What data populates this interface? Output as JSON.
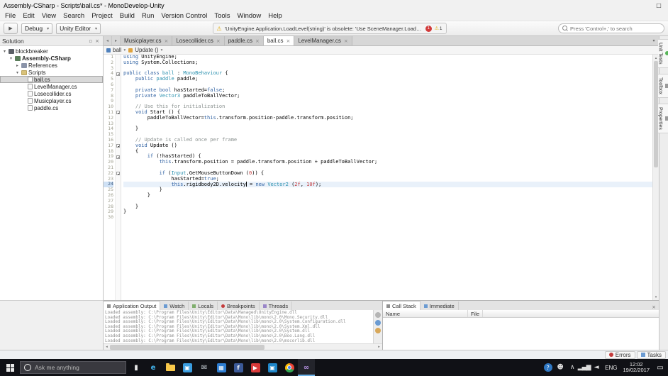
{
  "window": {
    "title": "Assembly-CSharp - Scripts\\ball.cs* - MonoDevelop-Unity",
    "controls": [
      {
        "name": "minimize",
        "glyph": "–"
      },
      {
        "name": "maximize",
        "glyph": "□"
      },
      {
        "name": "close",
        "glyph": "×"
      }
    ]
  },
  "icons": {
    "play": "▶",
    "chevron_down": "▾",
    "warning": "⚠",
    "close": "×",
    "back": "◂",
    "forward": "▸",
    "up": "▴",
    "down": "▾",
    "left": "◂",
    "right": "▸",
    "dock": "▫"
  },
  "menu": {
    "items": [
      "File",
      "Edit",
      "View",
      "Search",
      "Project",
      "Build",
      "Run",
      "Version Control",
      "Tools",
      "Window",
      "Help"
    ]
  },
  "toolbar": {
    "config": "Debug",
    "target": "Unity Editor",
    "warning": "'UnityEngine.Application.LoadLevel(string)' is obsolete: 'Use SceneManager.LoadScene' (CS0618)",
    "error_count": "1",
    "warning_count": "1",
    "search_placeholder": "Press 'Control+,' to search"
  },
  "solution": {
    "header": "Solution",
    "tree": [
      {
        "label": "blockbreaker",
        "level": 0,
        "icon": "solution",
        "arrow": "▾"
      },
      {
        "label": "Assembly-CSharp",
        "level": 1,
        "icon": "project",
        "arrow": "▾",
        "bold": true
      },
      {
        "label": "References",
        "level": 2,
        "icon": "references",
        "arrow": "▸"
      },
      {
        "label": "Scripts",
        "level": 2,
        "icon": "folder",
        "arrow": "▾"
      },
      {
        "label": "ball.cs",
        "level": 3,
        "icon": "file",
        "selected": true
      },
      {
        "label": "LevelManager.cs",
        "level": 3,
        "icon": "file"
      },
      {
        "label": "Losecollider.cs",
        "level": 3,
        "icon": "file"
      },
      {
        "label": "Musicplayer.cs",
        "level": 3,
        "icon": "file"
      },
      {
        "label": "paddle.cs",
        "level": 3,
        "icon": "file"
      }
    ]
  },
  "doc_tabs": [
    {
      "label": "Musicplayer.cs"
    },
    {
      "label": "Losecollider.cs"
    },
    {
      "label": "paddle.cs"
    },
    {
      "label": "ball.cs",
      "active": true
    },
    {
      "label": "LevelManager.cs"
    }
  ],
  "breadcrumb": [
    {
      "label": "ball"
    },
    {
      "label": "Update ()"
    }
  ],
  "editor": {
    "colors": {
      "keyword": "#3364a4",
      "type": "#2b91af",
      "comment": "#8a918f",
      "number": "#c43c3c",
      "plain": "#000000"
    },
    "lines": [
      {
        "n": 1,
        "seg": [
          [
            "k",
            "using"
          ],
          [
            "p",
            " UnityEngine;"
          ]
        ]
      },
      {
        "n": 2,
        "seg": [
          [
            "k",
            "using"
          ],
          [
            "p",
            " System.Collections;"
          ]
        ]
      },
      {
        "n": 3,
        "seg": []
      },
      {
        "n": 4,
        "fold": true,
        "seg": [
          [
            "k",
            "public"
          ],
          [
            "p",
            " "
          ],
          [
            "k",
            "class"
          ],
          [
            "p",
            " "
          ],
          [
            "t",
            "ball"
          ],
          [
            "p",
            " : "
          ],
          [
            "t",
            "MonoBehaviour"
          ],
          [
            "p",
            " {"
          ]
        ]
      },
      {
        "n": 5,
        "seg": [
          [
            "p",
            "    "
          ],
          [
            "k",
            "public"
          ],
          [
            "p",
            " "
          ],
          [
            "t",
            "paddle"
          ],
          [
            "p",
            " paddle;"
          ]
        ]
      },
      {
        "n": 6,
        "seg": []
      },
      {
        "n": 7,
        "seg": [
          [
            "p",
            "    "
          ],
          [
            "k",
            "private"
          ],
          [
            "p",
            " "
          ],
          [
            "k",
            "bool"
          ],
          [
            "p",
            " hasStarted="
          ],
          [
            "k",
            "false"
          ],
          [
            "p",
            ";"
          ]
        ]
      },
      {
        "n": 8,
        "seg": [
          [
            "p",
            "    "
          ],
          [
            "k",
            "private"
          ],
          [
            "p",
            " "
          ],
          [
            "t",
            "Vector3"
          ],
          [
            "p",
            " paddleToBallVector;"
          ]
        ]
      },
      {
        "n": 9,
        "seg": []
      },
      {
        "n": 10,
        "seg": [
          [
            "p",
            "    "
          ],
          [
            "c",
            "// Use this for initialization"
          ]
        ]
      },
      {
        "n": 11,
        "fold": true,
        "seg": [
          [
            "p",
            "    "
          ],
          [
            "k",
            "void"
          ],
          [
            "p",
            " Start () {"
          ]
        ]
      },
      {
        "n": 12,
        "seg": [
          [
            "p",
            "        paddleToBallVector="
          ],
          [
            "k",
            "this"
          ],
          [
            "p",
            ".transform.position-paddle.transform.position;"
          ]
        ]
      },
      {
        "n": 13,
        "seg": []
      },
      {
        "n": 14,
        "seg": [
          [
            "p",
            "    }"
          ]
        ]
      },
      {
        "n": 15,
        "seg": []
      },
      {
        "n": 16,
        "seg": [
          [
            "p",
            "    "
          ],
          [
            "c",
            "// Update is called once per frame"
          ]
        ]
      },
      {
        "n": 17,
        "fold": true,
        "seg": [
          [
            "p",
            "    "
          ],
          [
            "k",
            "void"
          ],
          [
            "p",
            " Update ()"
          ]
        ]
      },
      {
        "n": 18,
        "seg": [
          [
            "p",
            "    {"
          ]
        ]
      },
      {
        "n": 19,
        "fold": true,
        "seg": [
          [
            "p",
            "        "
          ],
          [
            "k",
            "if"
          ],
          [
            "p",
            " (!hasStarted) {"
          ]
        ]
      },
      {
        "n": 20,
        "seg": [
          [
            "p",
            "            "
          ],
          [
            "k",
            "this"
          ],
          [
            "p",
            ".transform.position = paddle.transform.position + paddleToBallVector;"
          ]
        ]
      },
      {
        "n": 21,
        "seg": []
      },
      {
        "n": 22,
        "fold": true,
        "seg": [
          [
            "p",
            "            "
          ],
          [
            "k",
            "if"
          ],
          [
            "p",
            " ("
          ],
          [
            "t",
            "Input"
          ],
          [
            "p",
            ".GetMouseButtonDown ("
          ],
          [
            "n2",
            "0"
          ],
          [
            "p",
            ")) {"
          ]
        ]
      },
      {
        "n": 23,
        "seg": [
          [
            "p",
            "                hasStarted="
          ],
          [
            "k",
            "true"
          ],
          [
            "p",
            ";"
          ]
        ]
      },
      {
        "n": 24,
        "cur": true,
        "seg": [
          [
            "p",
            "                "
          ],
          [
            "k",
            "this"
          ],
          [
            "p",
            ".rigidbody2D.velocity"
          ],
          [
            "caret",
            ""
          ],
          [
            "p",
            " = "
          ],
          [
            "k",
            "new"
          ],
          [
            "p",
            " "
          ],
          [
            "t",
            "Vector2"
          ],
          [
            "p",
            " ("
          ],
          [
            "n2",
            "2f"
          ],
          [
            "p",
            ", "
          ],
          [
            "n2",
            "10f"
          ],
          [
            "p",
            ");"
          ]
        ]
      },
      {
        "n": 25,
        "seg": [
          [
            "p",
            "            }"
          ]
        ]
      },
      {
        "n": 26,
        "seg": [
          [
            "p",
            "        }"
          ]
        ]
      },
      {
        "n": 27,
        "seg": []
      },
      {
        "n": 28,
        "seg": [
          [
            "p",
            "    }"
          ]
        ]
      },
      {
        "n": 29,
        "seg": [
          [
            "p",
            "}"
          ]
        ]
      },
      {
        "n": 30,
        "seg": []
      }
    ]
  },
  "right_dock": {
    "tabs": [
      {
        "label": "Unit Tests"
      },
      {
        "label": "Toolbox"
      },
      {
        "label": "Properties"
      }
    ]
  },
  "bottom_left": {
    "tabs": [
      {
        "label": "Application Output",
        "active": true
      },
      {
        "label": "Watch"
      },
      {
        "label": "Locals"
      },
      {
        "label": "Breakpoints"
      },
      {
        "label": "Threads"
      }
    ],
    "output": [
      "Loaded assembly: C:\\Program Files\\Unity\\Editor\\Data\\Managed\\UnityEngine.dll",
      "Loaded assembly: C:\\Program Files\\Unity\\Editor\\Data\\Mono\\lib\\mono\\2.0\\Mono.Security.dll",
      "Loaded assembly: C:\\Program Files\\Unity\\Editor\\Data\\Mono\\lib\\mono\\2.0\\System.Configuration.dll",
      "Loaded assembly: C:\\Program Files\\Unity\\Editor\\Data\\Mono\\lib\\mono\\2.0\\System.Xml.dll",
      "Loaded assembly: C:\\Program Files\\Unity\\Editor\\Data\\Mono\\lib\\mono\\2.0\\System.dll",
      "Loaded assembly: C:\\Program Files\\Unity\\Editor\\Data\\Mono\\lib\\mono\\2.0\\Boo.Lang.dll",
      "Loaded assembly: C:\\Program Files\\Unity\\Editor\\Data\\Mono\\lib\\mono\\2.0\\mscorlib.dll"
    ]
  },
  "bottom_right": {
    "tabs": [
      {
        "label": "Call Stack",
        "active": true
      },
      {
        "label": "Immediate"
      }
    ],
    "columns": [
      "Name",
      "File"
    ]
  },
  "status": {
    "buttons": [
      {
        "label": "Errors"
      },
      {
        "label": "Tasks"
      }
    ]
  },
  "taskbar": {
    "search": "Ask me anything",
    "apps": [
      {
        "name": "microphone-icon",
        "glyph": "▮",
        "fg": "#e8e8e8"
      },
      {
        "name": "edge-icon",
        "glyph": "e",
        "fg": "#44b8f3",
        "bold": true
      },
      {
        "name": "file-explorer-icon",
        "shape": "folder"
      },
      {
        "name": "store-icon",
        "glyph": "▣",
        "fg": "#ffffff",
        "bg": "#3a9de0"
      },
      {
        "name": "mail-icon",
        "glyph": "✉",
        "fg": "#cfd8df"
      },
      {
        "name": "calendar-icon",
        "glyph": "▦",
        "fg": "#ffffff",
        "bg": "#2d7dd2"
      },
      {
        "name": "facebook-icon",
        "glyph": "f",
        "fg": "#ffffff",
        "bg": "#3b5998",
        "bold": true
      },
      {
        "name": "video-app-icon",
        "glyph": "▶",
        "fg": "#ffffff",
        "bg": "#d93a3a"
      },
      {
        "name": "photos-icon",
        "glyph": "▣",
        "fg": "#ffffff",
        "bg": "#1f86c9"
      },
      {
        "name": "chrome-icon",
        "shape": "chrome"
      },
      {
        "name": "monodevelop-icon",
        "glyph": "∞",
        "fg": "#b490e0",
        "bold": true,
        "active": true
      }
    ],
    "tray": {
      "icons": [
        {
          "name": "help-icon",
          "glyph": "?",
          "fg": "#ffffff",
          "bg": "#2f78c4",
          "shape": "circle"
        },
        {
          "name": "people-icon",
          "glyph": "☻",
          "fg": "#dddddd"
        },
        {
          "name": "chevron-up-icon",
          "glyph": "∧",
          "fg": "#dddddd"
        },
        {
          "name": "network-icon",
          "glyph": "▂▄▆",
          "fg": "#dddddd"
        },
        {
          "name": "volume-icon",
          "glyph": "◄",
          "fg": "#dddddd"
        }
      ],
      "lang": "ENG",
      "time": "12:02",
      "date": "19/02/2017",
      "notification_glyph": "▭"
    }
  }
}
